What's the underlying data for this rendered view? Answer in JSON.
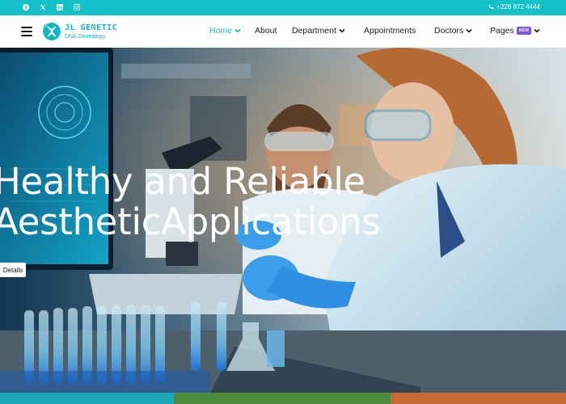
{
  "topbar": {
    "social_icons": [
      "facebook-icon",
      "x-twitter-icon",
      "linkedin-icon",
      "instagram-icon"
    ],
    "phone": "+228 872 4444",
    "bg_color": "#14c1c9"
  },
  "logo": {
    "title": "JL GENETIC",
    "subtitle": "DNA Genealogy"
  },
  "nav": {
    "home": "Home",
    "about": "About",
    "department": "Department",
    "appointments": "Appointments",
    "doctors": "Doctors",
    "pages": "Pages",
    "pages_badge": "NEW"
  },
  "hero": {
    "line1": "Healthy and Reliable",
    "line2": "AestheticApplications",
    "button": "Details"
  },
  "colors": {
    "accent": "#14b6c4",
    "badge": "#7a57e6",
    "strip": [
      "#1aa8b6",
      "#4e8a3c",
      "#c56a34"
    ]
  }
}
